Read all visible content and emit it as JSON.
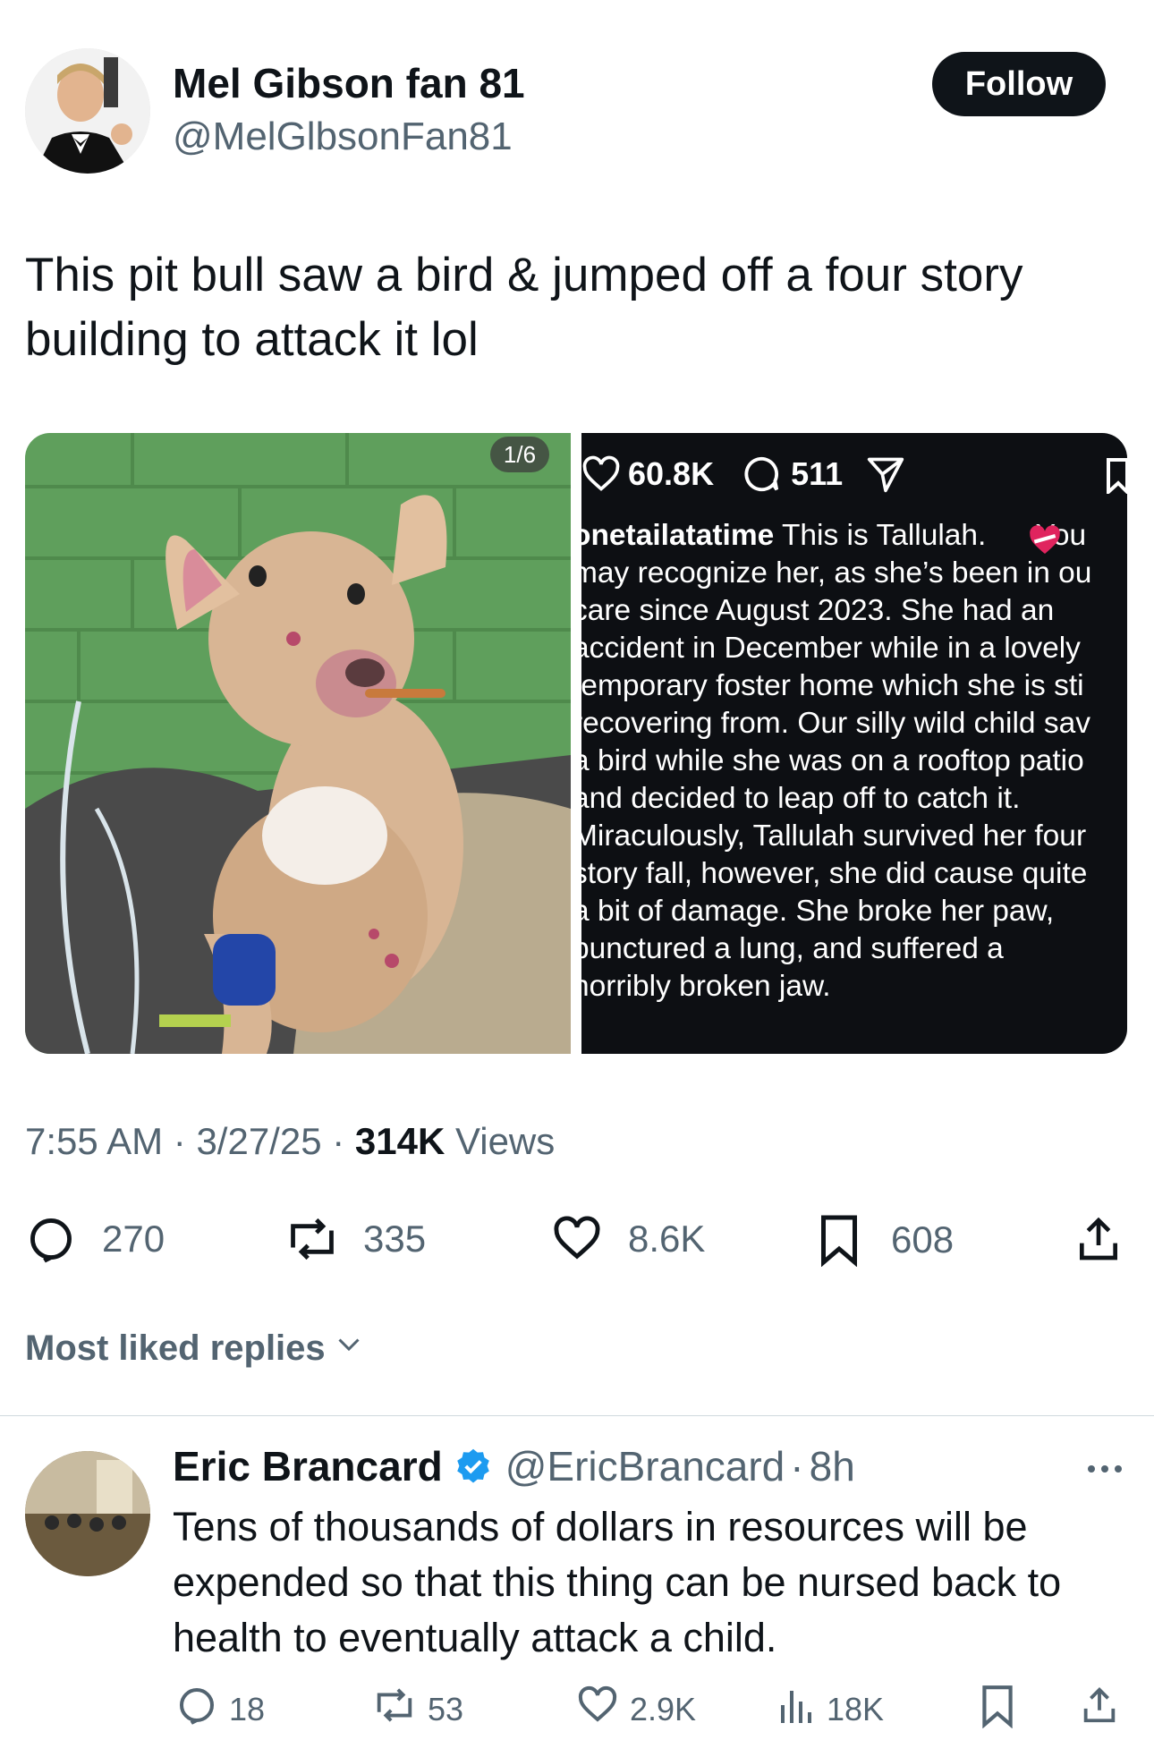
{
  "tweet": {
    "author_name": "Mel Gibson fan 81",
    "author_handle": "@MelGlbsonFan81",
    "follow_label": "Follow",
    "text": "This pit bull saw a bird & jumped off a four story building to attack it lol",
    "media_counter": "1/6",
    "embedded_post": {
      "likes": "60.8K",
      "comments": "511",
      "caption_user": "onetailatatime",
      "caption_lines": [
        " This is Tallulah.      You",
        "may recognize her, as she’s been in ou",
        "care since August 2023. She had an",
        "accident in December while in a lovely",
        "temporary foster home which she is sti",
        "recovering from. Our silly wild child sav",
        "a bird while she was on a rooftop patio",
        "and decided to leap off to catch it.",
        "Miraculously, Tallulah survived her four",
        "story fall, however, she did cause quite",
        "a bit of damage. She broke her paw,",
        "punctured a lung, and suffered a",
        "horribly broken jaw."
      ]
    },
    "time": "7:55 AM",
    "date": "3/27/25",
    "views_count": "314K",
    "views_label": "Views",
    "replies": "270",
    "reposts": "335",
    "likes": "8.6K",
    "bookmarks": "608"
  },
  "most_liked_label": "Most liked replies",
  "reply": {
    "author_name": "Eric Brancard",
    "author_handle": "@EricBrancard",
    "age": "8h",
    "text": "Tens of thousands of dollars in resources will be expended so that this thing can be nursed back to health to eventually attack a child.",
    "replies": "18",
    "reposts": "53",
    "likes": "2.9K",
    "views": "18K"
  },
  "colors": {
    "text_primary": "#0f1419",
    "text_secondary": "#536471",
    "verified_blue": "#1d9bf0",
    "wall_green": "#5f9f5c"
  }
}
